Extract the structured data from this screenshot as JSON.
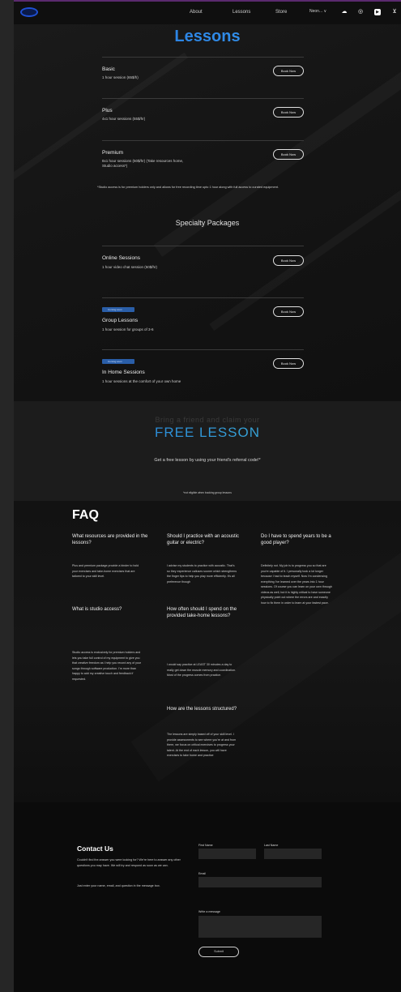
{
  "header": {
    "nav": [
      "About",
      "Lessons",
      "Store"
    ],
    "select_value": "Neon... ∨"
  },
  "lessons": {
    "title": "Lessons",
    "packages": [
      {
        "name": "Basic",
        "desc": "1 hour session (65$/h)",
        "button": "Book Now"
      },
      {
        "name": "Plus",
        "desc": "4x1 hour sessions (55$/hr)",
        "button": "Book Now"
      },
      {
        "name": "Premium",
        "desc": "8x1 hour sessions (50$/hr) (Take resources home, Studio access*)",
        "button": "Book Now"
      }
    ],
    "note": "*Studio access is for premium holders only and allows for free recording time upto 1 hour along with full access to curated equipment.",
    "specialty_title": "Specialty Packages",
    "specialty": [
      {
        "name": "Online Sessions",
        "desc": "1 hour video chat session (50$/hr)",
        "button": "Book Now"
      },
      {
        "badge": "Coming soon",
        "name": "Group Lessons",
        "desc": "1 hour session for groups of 3-6",
        "button": "Book Now"
      },
      {
        "badge": "Coming soon",
        "name": "In Home Sessions",
        "desc": "1 hour sessions at the comfort of your own home",
        "button": "Book Now"
      }
    ]
  },
  "referral": {
    "sub": "Bring a friend and claim your",
    "big": "FREE LESSON",
    "text": "Get a free lesson by using your friend's referral code!*",
    "fine": "*not eligible when booking group lessons"
  },
  "faq": {
    "title": "FAQ",
    "items": [
      {
        "q": "What resources are provided in the lessons?",
        "a": "Plus and premium package provide a binder to hold your exercises and take-home exercises that are tailored to your skill level."
      },
      {
        "q": "What is studio access?",
        "a": "Studio access is exclusively for premium holders and lets you take full control of my equipment to give you that creative freedom as I help you record any of your songs through software production. I'm more than happy to add my creative touch and feedback if requested."
      },
      {
        "q": "Should I practice with an acoustic guitar or electric?",
        "a": "I advise my students to practice with acoustic. That's so they experience calluses sooner which strengthens the finger tips to help you play more efficiently. It's all preference though"
      },
      {
        "q": "How often should I spend on the provided take-home lessons?",
        "a": "I would say practice at LEAST 30 minutes a day to really get down the muscle memory and coordination. Most of the progress comes from practice."
      },
      {
        "q": "How are the lessons structured?",
        "a": "The lessons are simply based off of your skill level. I provide assessments to see where you're at and from there, we focus on critical exercises to progress your talent. At the end of each lesson, you will have exercises to take home and practice"
      },
      {
        "q": "Do I have to spend years to be a good player?",
        "a": "Definitely not. My job is to progress you so that are you're capable of it. I personally took a lot longer because I had to teach myself. Now I'm condensing everything I've learned over the years into 1 hour sessions. Of course you can learn on your own through videos as well, but it is highly critical to have someone physically point out where the errors are and exactly how to fix them in order to learn at your fastest pace."
      }
    ]
  },
  "contact": {
    "title": "Contact Us",
    "text1": "Couldn't find the answer you were looking for? We're here to answer any other questions you may have. We will try and respond as soon as we can.",
    "text2": "Just enter your name, email, and question in the message box.",
    "first_name": "First Name",
    "last_name": "Last Name",
    "email": "Email",
    "message": "Write a message",
    "submit": "Submit"
  }
}
